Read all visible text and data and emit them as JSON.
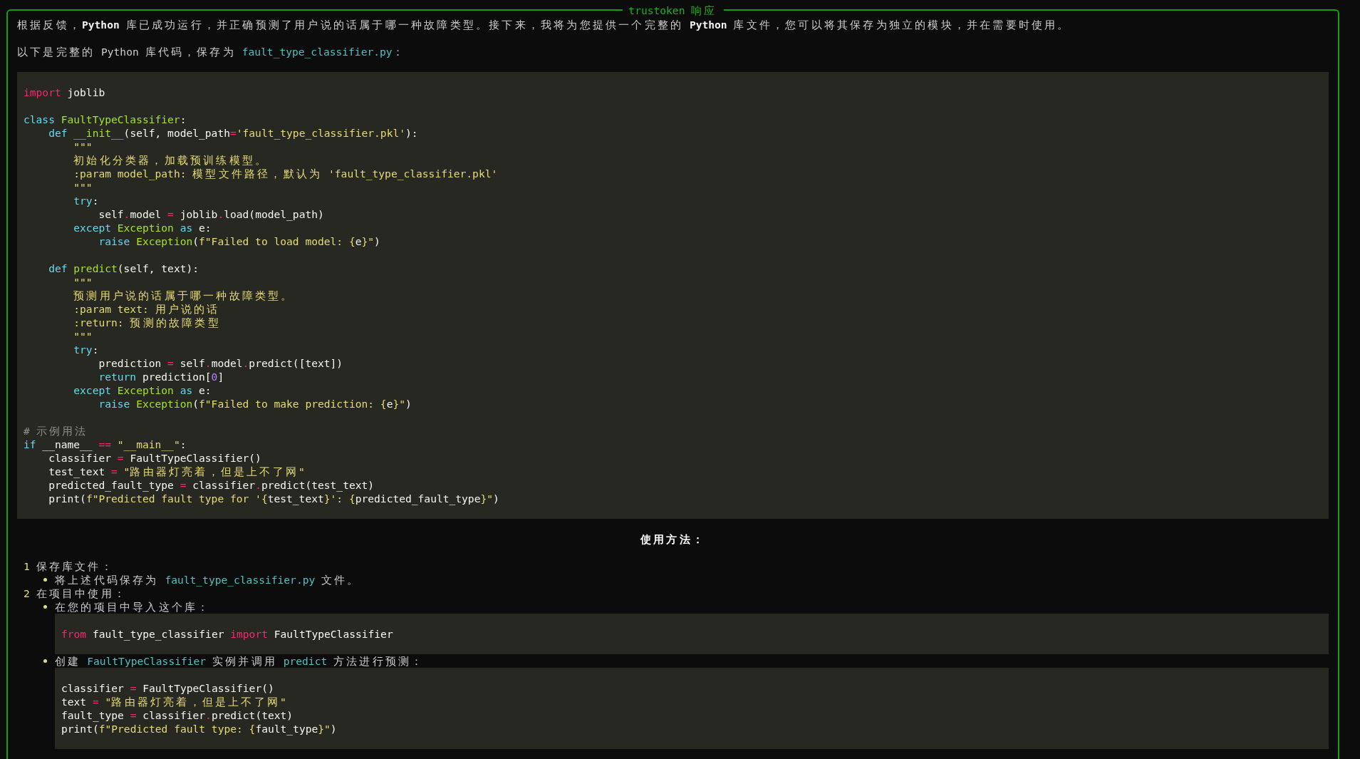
{
  "panel": {
    "title": "trustoken 响应"
  },
  "intro": [
    {
      "segments": [
        {
          "kind": "text",
          "text": "根据反馈，"
        },
        {
          "kind": "strong",
          "text": "Python"
        },
        {
          "kind": "text",
          "text": " 库已成功运行，并正确预测了用户说的话属于哪一种故障类型。接下来，我将为您提供一个完整的 "
        },
        {
          "kind": "strong",
          "text": "Python"
        },
        {
          "kind": "text",
          "text": " 库文件，您可以将其保存为独立的模块，并在需要时使用。"
        }
      ]
    },
    {
      "segments": [
        {
          "kind": "text",
          "text": "以下是完整的 Python 库代码，保存为 "
        },
        {
          "kind": "code",
          "text": "fault_type_classifier.py"
        },
        {
          "kind": "text",
          "text": "："
        }
      ]
    }
  ],
  "code_block": {
    "sections": [
      [
        {
          "tokens": [
            {
              "kind": "keyword",
              "text": "import"
            },
            {
              "kind": "plain",
              "text": " joblib"
            }
          ]
        }
      ],
      [
        {
          "tokens": [
            {
              "kind": "storage",
              "text": "class"
            },
            {
              "kind": "entity",
              "text": " FaultTypeClassifier"
            },
            {
              "kind": "plain",
              "text": ":"
            }
          ]
        },
        {
          "tokens": [
            {
              "kind": "storage",
              "text": "    def"
            },
            {
              "kind": "entity",
              "text": " __init__"
            },
            {
              "kind": "plain",
              "text": "(self, model_path"
            },
            {
              "kind": "keyword",
              "text": "="
            },
            {
              "kind": "string",
              "text": "'fault_type_classifier.pkl'"
            },
            {
              "kind": "plain",
              "text": "):"
            }
          ]
        },
        {
          "tokens": [
            {
              "kind": "string",
              "text": "        \"\"\""
            }
          ]
        },
        {
          "tokens": [
            {
              "kind": "string",
              "text": "        初始化分类器，加载预训练模型。"
            }
          ]
        },
        {
          "tokens": [
            {
              "kind": "string",
              "text": "        :param model_path: 模型文件路径，默认为 'fault_type_classifier.pkl'"
            }
          ]
        },
        {
          "tokens": [
            {
              "kind": "string",
              "text": "        \"\"\""
            }
          ]
        },
        {
          "tokens": [
            {
              "kind": "storage",
              "text": "        try"
            },
            {
              "kind": "plain",
              "text": ":"
            }
          ]
        },
        {
          "tokens": [
            {
              "kind": "plain",
              "text": "            self"
            },
            {
              "kind": "keyword",
              "text": "."
            },
            {
              "kind": "plain",
              "text": "model "
            },
            {
              "kind": "keyword",
              "text": "="
            },
            {
              "kind": "plain",
              "text": " joblib"
            },
            {
              "kind": "keyword",
              "text": "."
            },
            {
              "kind": "plain",
              "text": "load(model_path)"
            }
          ]
        },
        {
          "tokens": [
            {
              "kind": "storage",
              "text": "        except"
            },
            {
              "kind": "entity",
              "text": " Exception"
            },
            {
              "kind": "storage",
              "text": " as"
            },
            {
              "kind": "plain",
              "text": " e:"
            }
          ]
        },
        {
          "tokens": [
            {
              "kind": "storage",
              "text": "            raise"
            },
            {
              "kind": "entity",
              "text": " Exception"
            },
            {
              "kind": "plain",
              "text": "("
            },
            {
              "kind": "string",
              "text": "f\"Failed to load model: {"
            },
            {
              "kind": "plain",
              "text": "e"
            },
            {
              "kind": "string",
              "text": "}\""
            },
            {
              "kind": "plain",
              "text": ")"
            }
          ]
        }
      ],
      [
        {
          "tokens": [
            {
              "kind": "storage",
              "text": "    def"
            },
            {
              "kind": "entity",
              "text": " predict"
            },
            {
              "kind": "plain",
              "text": "(self, text):"
            }
          ]
        },
        {
          "tokens": [
            {
              "kind": "string",
              "text": "        \"\"\""
            }
          ]
        },
        {
          "tokens": [
            {
              "kind": "string",
              "text": "        预测用户说的话属于哪一种故障类型。"
            }
          ]
        },
        {
          "tokens": [
            {
              "kind": "string",
              "text": "        :param text: 用户说的话"
            }
          ]
        },
        {
          "tokens": [
            {
              "kind": "string",
              "text": "        :return: 预测的故障类型"
            }
          ]
        },
        {
          "tokens": [
            {
              "kind": "string",
              "text": "        \"\"\""
            }
          ]
        },
        {
          "tokens": [
            {
              "kind": "storage",
              "text": "        try"
            },
            {
              "kind": "plain",
              "text": ":"
            }
          ]
        },
        {
          "tokens": [
            {
              "kind": "plain",
              "text": "            prediction "
            },
            {
              "kind": "keyword",
              "text": "="
            },
            {
              "kind": "plain",
              "text": " self"
            },
            {
              "kind": "keyword",
              "text": "."
            },
            {
              "kind": "plain",
              "text": "model"
            },
            {
              "kind": "keyword",
              "text": "."
            },
            {
              "kind": "plain",
              "text": "predict([text])"
            }
          ]
        },
        {
          "tokens": [
            {
              "kind": "storage",
              "text": "            return"
            },
            {
              "kind": "plain",
              "text": " prediction["
            },
            {
              "kind": "number",
              "text": "0"
            },
            {
              "kind": "plain",
              "text": "]"
            }
          ]
        },
        {
          "tokens": [
            {
              "kind": "storage",
              "text": "        except"
            },
            {
              "kind": "entity",
              "text": " Exception"
            },
            {
              "kind": "storage",
              "text": " as"
            },
            {
              "kind": "plain",
              "text": " e:"
            }
          ]
        },
        {
          "tokens": [
            {
              "kind": "storage",
              "text": "            raise"
            },
            {
              "kind": "entity",
              "text": " Exception"
            },
            {
              "kind": "plain",
              "text": "("
            },
            {
              "kind": "string",
              "text": "f\"Failed to make prediction: {"
            },
            {
              "kind": "plain",
              "text": "e"
            },
            {
              "kind": "string",
              "text": "}\""
            },
            {
              "kind": "plain",
              "text": ")"
            }
          ]
        }
      ],
      [
        {
          "tokens": [
            {
              "kind": "comment",
              "text": "# 示例用法"
            }
          ]
        },
        {
          "tokens": [
            {
              "kind": "storage",
              "text": "if"
            },
            {
              "kind": "plain",
              "text": " __name__ "
            },
            {
              "kind": "keyword",
              "text": "=="
            },
            {
              "kind": "string",
              "text": " \"__main__\""
            },
            {
              "kind": "plain",
              "text": ":"
            }
          ]
        },
        {
          "tokens": [
            {
              "kind": "plain",
              "text": "    classifier "
            },
            {
              "kind": "keyword",
              "text": "="
            },
            {
              "kind": "plain",
              "text": " FaultTypeClassifier()"
            }
          ]
        },
        {
          "tokens": [
            {
              "kind": "plain",
              "text": "    test_text "
            },
            {
              "kind": "keyword",
              "text": "="
            },
            {
              "kind": "string",
              "text": " \"路由器灯亮着，但是上不了网\""
            }
          ]
        },
        {
          "tokens": [
            {
              "kind": "plain",
              "text": "    predicted_fault_type "
            },
            {
              "kind": "keyword",
              "text": "="
            },
            {
              "kind": "plain",
              "text": " classifier"
            },
            {
              "kind": "keyword",
              "text": "."
            },
            {
              "kind": "plain",
              "text": "predict(test_text)"
            }
          ]
        },
        {
          "tokens": [
            {
              "kind": "plain",
              "text": "    print("
            },
            {
              "kind": "string",
              "text": "f\"Predicted fault type for '{"
            },
            {
              "kind": "plain",
              "text": "test_text"
            },
            {
              "kind": "string",
              "text": "}': {"
            },
            {
              "kind": "plain",
              "text": "predicted_fault_type"
            },
            {
              "kind": "string",
              "text": "}\""
            },
            {
              "kind": "plain",
              "text": ")"
            }
          ]
        }
      ]
    ]
  },
  "usage_heading": "使用方法：",
  "steps": [
    {
      "number": "1",
      "title": "保存库文件：",
      "bullets": [
        {
          "segments": [
            {
              "kind": "text",
              "text": "将上述代码保存为 "
            },
            {
              "kind": "code",
              "text": "fault_type_classifier.py"
            },
            {
              "kind": "text",
              "text": " 文件。"
            }
          ]
        }
      ]
    },
    {
      "number": "2",
      "title": "在项目中使用：",
      "bullets": [
        {
          "segments": [
            {
              "kind": "text",
              "text": "在您的项目中导入这个库："
            }
          ],
          "code": {
            "sections": [
              [
                {
                  "tokens": [
                    {
                      "kind": "keyword",
                      "text": "from"
                    },
                    {
                      "kind": "plain",
                      "text": " fault_type_classifier "
                    },
                    {
                      "kind": "keyword",
                      "text": "import"
                    },
                    {
                      "kind": "plain",
                      "text": " FaultTypeClassifier"
                    }
                  ]
                }
              ]
            ]
          }
        },
        {
          "segments": [
            {
              "kind": "text",
              "text": "创建 "
            },
            {
              "kind": "code",
              "text": "FaultTypeClassifier"
            },
            {
              "kind": "text",
              "text": " 实例并调用 "
            },
            {
              "kind": "code",
              "text": "predict"
            },
            {
              "kind": "text",
              "text": " 方法进行预测："
            }
          ],
          "code": {
            "sections": [
              [
                {
                  "tokens": [
                    {
                      "kind": "plain",
                      "text": "classifier "
                    },
                    {
                      "kind": "keyword",
                      "text": "="
                    },
                    {
                      "kind": "plain",
                      "text": " FaultTypeClassifier()"
                    }
                  ]
                },
                {
                  "tokens": [
                    {
                      "kind": "plain",
                      "text": "text "
                    },
                    {
                      "kind": "keyword",
                      "text": "="
                    },
                    {
                      "kind": "string",
                      "text": " \"路由器灯亮着，但是上不了网\""
                    }
                  ]
                },
                {
                  "tokens": [
                    {
                      "kind": "plain",
                      "text": "fault_type "
                    },
                    {
                      "kind": "keyword",
                      "text": "="
                    },
                    {
                      "kind": "plain",
                      "text": " classifier"
                    },
                    {
                      "kind": "keyword",
                      "text": "."
                    },
                    {
                      "kind": "plain",
                      "text": "predict(text)"
                    }
                  ]
                },
                {
                  "tokens": [
                    {
                      "kind": "plain",
                      "text": "print("
                    },
                    {
                      "kind": "string",
                      "text": "f\"Predicted fault type: {"
                    },
                    {
                      "kind": "plain",
                      "text": "fault_type"
                    },
                    {
                      "kind": "string",
                      "text": "}\""
                    },
                    {
                      "kind": "plain",
                      "text": ")"
                    }
                  ]
                }
              ]
            ]
          }
        }
      ]
    }
  ]
}
